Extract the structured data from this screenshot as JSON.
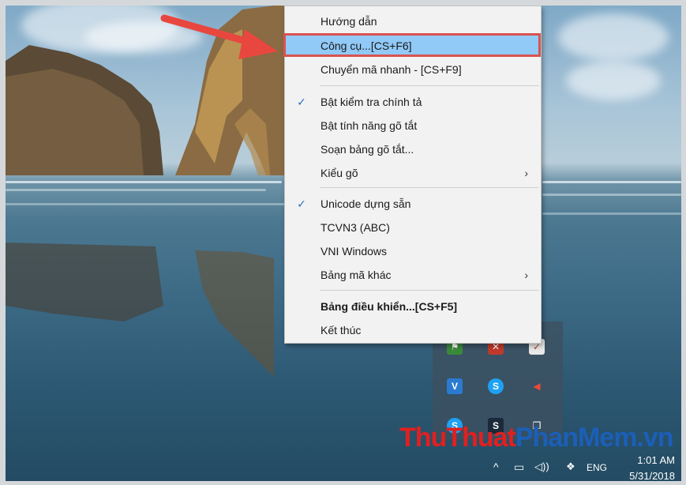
{
  "menu": {
    "items": [
      {
        "label": "Hướng dẫn",
        "checked": false,
        "submenu": false,
        "highlighted": false,
        "bold": false
      },
      {
        "label": "Công cụ...[CS+F6]",
        "checked": false,
        "submenu": false,
        "highlighted": true,
        "bold": false
      },
      {
        "label": "Chuyển mã nhanh - [CS+F9]",
        "checked": false,
        "submenu": false,
        "highlighted": false,
        "bold": false
      },
      {
        "label": "Bật kiểm tra chính tả",
        "checked": true,
        "submenu": false,
        "highlighted": false,
        "bold": false
      },
      {
        "label": "Bật tính năng gõ tắt",
        "checked": false,
        "submenu": false,
        "highlighted": false,
        "bold": false
      },
      {
        "label": "Soạn bảng gõ tắt...",
        "checked": false,
        "submenu": false,
        "highlighted": false,
        "bold": false
      },
      {
        "label": "Kiểu gõ",
        "checked": false,
        "submenu": true,
        "highlighted": false,
        "bold": false
      },
      {
        "label": "Unicode dựng sẵn",
        "checked": true,
        "submenu": false,
        "highlighted": false,
        "bold": false
      },
      {
        "label": "TCVN3 (ABC)",
        "checked": false,
        "submenu": false,
        "highlighted": false,
        "bold": false
      },
      {
        "label": "VNI Windows",
        "checked": false,
        "submenu": false,
        "highlighted": false,
        "bold": false
      },
      {
        "label": "Bảng mã khác",
        "checked": false,
        "submenu": true,
        "highlighted": false,
        "bold": false
      },
      {
        "label": "Bảng điều khiển...[CS+F5]",
        "checked": false,
        "submenu": false,
        "highlighted": false,
        "bold": true
      },
      {
        "label": "Kết thúc",
        "checked": false,
        "submenu": false,
        "highlighted": false,
        "bold": false
      }
    ],
    "check_glyph": "✓",
    "submenu_glyph": "›"
  },
  "watermark": {
    "part1": "ThuThuat",
    "part2": "PhanMem.vn"
  },
  "taskbar": {
    "language": "ENG",
    "time": "1:01 AM",
    "date": "5/31/2018",
    "icons": [
      "chevron-up-icon",
      "network-icon",
      "volume-icon",
      "dropbox-icon"
    ]
  },
  "tray_icons": [
    "flag-icon",
    "unikey-error-icon",
    "check-icon",
    "unikey-icon",
    "skype-icon",
    "speaker-icon",
    "skype-icon",
    "s-app-icon",
    "copy-icon"
  ],
  "colors": {
    "highlight": "#91c9f7",
    "highlight_border": "#d9534f",
    "arrow": "#e8473f"
  }
}
